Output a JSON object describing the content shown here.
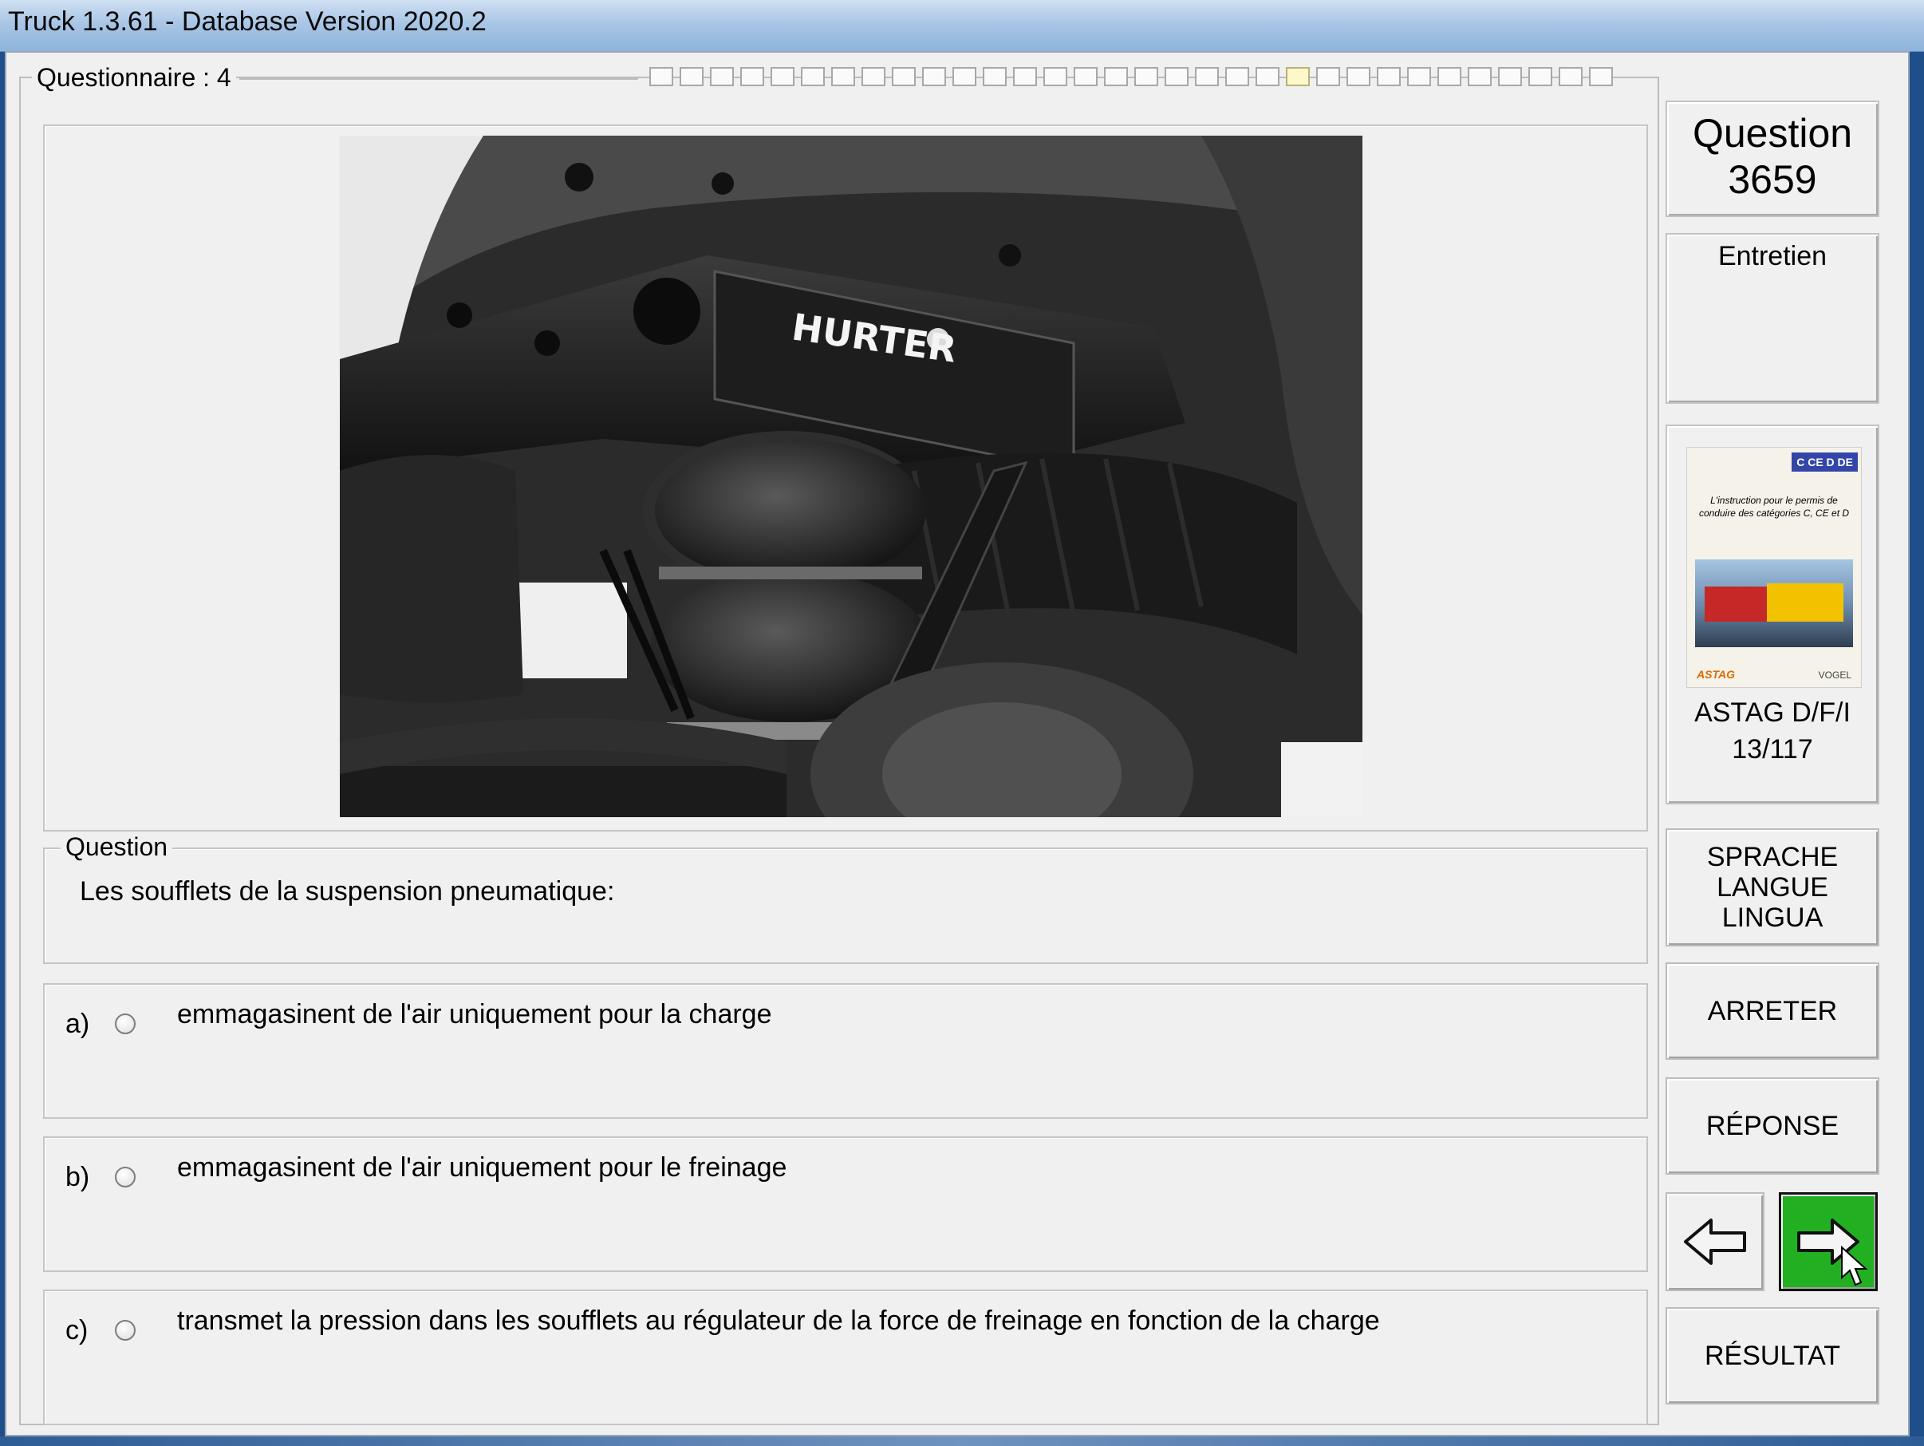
{
  "window": {
    "title": "Truck 1.3.61 - Database Version 2020.2"
  },
  "questionnaire": {
    "label": "Questionnaire : 4",
    "progress_total": 32,
    "progress_current": 21
  },
  "image": {
    "brand_text": "HURTER"
  },
  "side": {
    "question_label": "Question",
    "question_number": "3659",
    "category": "Entretien",
    "book_badge": "C CE D DE",
    "book_text": "L'instruction pour le permis de conduire des catégories C, CE et D",
    "book_logo_left": "ASTAG",
    "book_logo_right": "VOGEL",
    "source_line1": "ASTAG D/F/I",
    "source_line2": "13/117"
  },
  "question": {
    "legend": "Question",
    "text": "Les soufflets de la suspension pneumatique:"
  },
  "answers": [
    {
      "letter": "a)",
      "text": "emmagasinent de l'air uniquement pour la charge"
    },
    {
      "letter": "b)",
      "text": "emmagasinent de l'air uniquement pour le freinage"
    },
    {
      "letter": "c)",
      "text": "transmet la pression dans les soufflets au régulateur de la force de freinage en fonction de la charge"
    }
  ],
  "buttons": {
    "language_line1": "SPRACHE",
    "language_line2": "LANGUE",
    "language_line3": "LINGUA",
    "stop": "ARRETER",
    "answer": "RÉPONSE",
    "result": "RÉSULTAT"
  },
  "colors": {
    "next_button_green": "#22b022",
    "window_bg": "#f0f0f0",
    "titlebar_blue": "#a9c6e6"
  }
}
